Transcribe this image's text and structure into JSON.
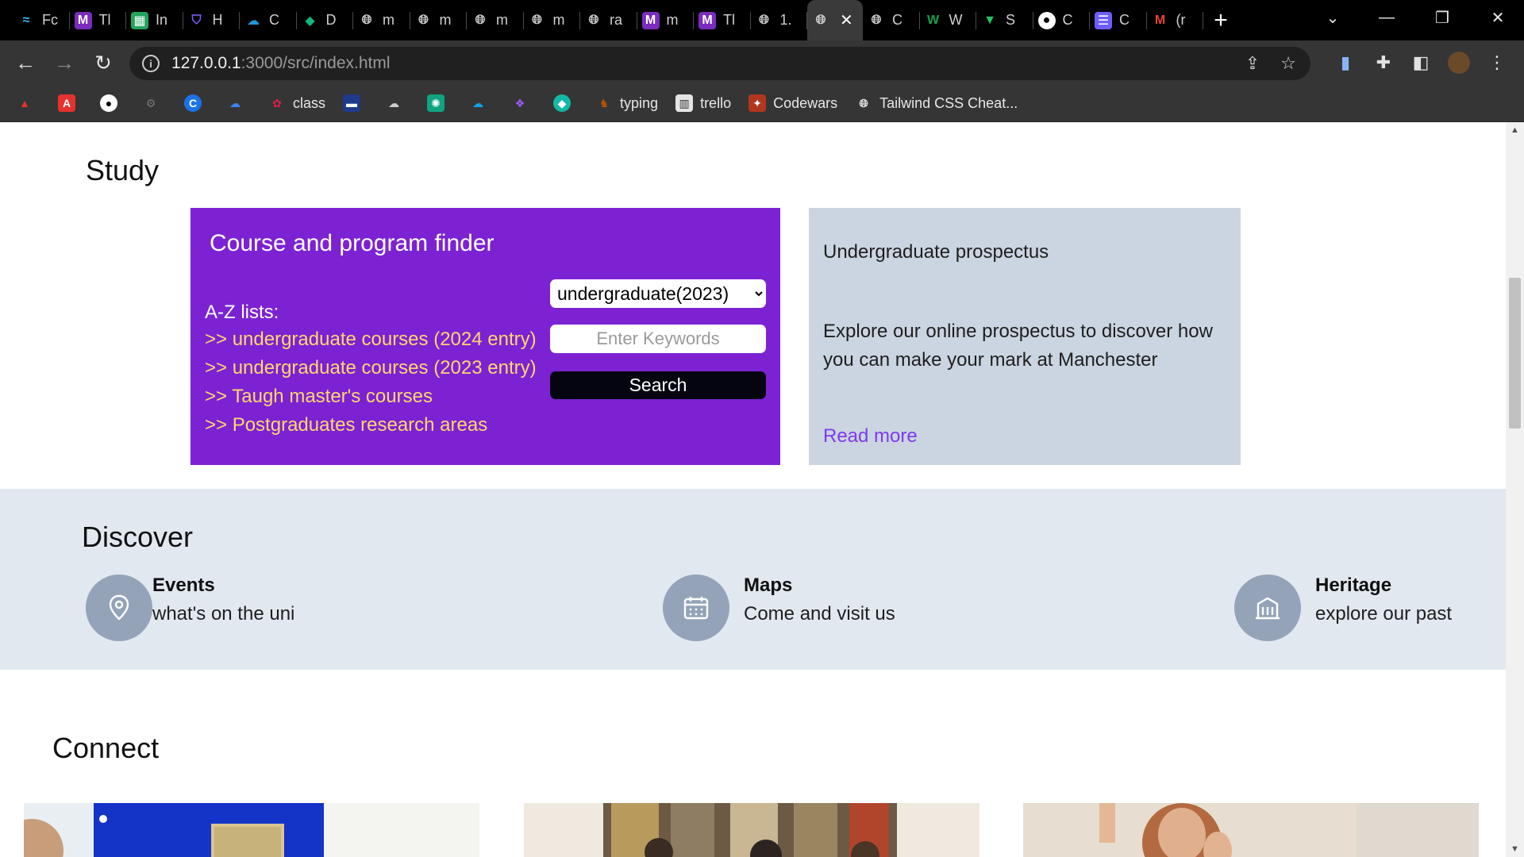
{
  "browser": {
    "tabs": [
      {
        "label": "Fc",
        "icon": "tailwind-icon",
        "color": "#38bdf8"
      },
      {
        "label": "Tl",
        "icon": "m-logo-icon",
        "color": "#7b2cbf"
      },
      {
        "label": "In",
        "icon": "sheet-icon",
        "color": "#22a45d"
      },
      {
        "label": "H",
        "icon": "shield-icon",
        "color": "#7b61ff"
      },
      {
        "label": "C",
        "icon": "cloud-icon",
        "color": "#1e9bd7"
      },
      {
        "label": "D",
        "icon": "droplet-icon",
        "color": "#10b981"
      },
      {
        "label": "m",
        "icon": "globe-icon",
        "color": "#cfcfcf"
      },
      {
        "label": "m",
        "icon": "globe-icon",
        "color": "#cfcfcf"
      },
      {
        "label": "m",
        "icon": "globe-icon",
        "color": "#cfcfcf"
      },
      {
        "label": "m",
        "icon": "globe-icon",
        "color": "#cfcfcf"
      },
      {
        "label": "ra",
        "icon": "globe-icon",
        "color": "#cfcfcf"
      },
      {
        "label": "m",
        "icon": "m-logo-icon",
        "color": "#7b2cbf"
      },
      {
        "label": "Tl",
        "icon": "m-logo-icon",
        "color": "#7b2cbf"
      },
      {
        "label": "1.",
        "icon": "globe-icon",
        "color": "#cfcfcf"
      },
      {
        "label": "",
        "icon": "globe-icon",
        "color": "#cfcfcf",
        "active": true
      },
      {
        "label": "C",
        "icon": "globe-icon",
        "color": "#cfcfcf"
      },
      {
        "label": "W",
        "icon": "w-logo-icon",
        "color": "#16a34a"
      },
      {
        "label": "S",
        "icon": "vue-icon",
        "color": "#22c55e"
      },
      {
        "label": "C",
        "icon": "github-icon",
        "color": "#ffffff"
      },
      {
        "label": "C",
        "icon": "list-icon",
        "color": "#6d5dfc"
      },
      {
        "label": "(r",
        "icon": "gmail-icon",
        "color": "#ea4335"
      }
    ],
    "url_host": "127.0.0.1",
    "url_path": ":3000/src/index.html",
    "bookmarks": [
      {
        "label": "",
        "icon": "adobe-icon",
        "color": "#e5322d"
      },
      {
        "label": "",
        "icon": "pdf-icon",
        "color": "#e5322d"
      },
      {
        "label": "",
        "icon": "github-icon",
        "color": "#222"
      },
      {
        "label": "",
        "icon": "bike-icon",
        "color": "#555"
      },
      {
        "label": "",
        "icon": "c-logo-icon",
        "color": "#1a73e8"
      },
      {
        "label": "",
        "icon": "cloud-icon",
        "color": "#3b82f6"
      },
      {
        "label": "class",
        "icon": "gear-icon",
        "color": "#e11d48"
      },
      {
        "label": "",
        "icon": "bar-icon",
        "color": "#1e3a8a"
      },
      {
        "label": "",
        "icon": "cloud-icon",
        "color": "#888"
      },
      {
        "label": "",
        "icon": "openai-icon",
        "color": "#10a37f"
      },
      {
        "label": "",
        "icon": "salesforce-icon",
        "color": "#0ea5e9"
      },
      {
        "label": "",
        "icon": "figma-icon",
        "color": "#a259ff"
      },
      {
        "label": "",
        "icon": "diamond-icon",
        "color": "#14b8a6"
      },
      {
        "label": "typing",
        "icon": "keyboard-icon",
        "color": "#b45309"
      },
      {
        "label": "trello",
        "icon": "trello-icon",
        "color": "#e5e5e5"
      },
      {
        "label": "Codewars",
        "icon": "codewars-icon",
        "color": "#b1361e"
      },
      {
        "label": "Tailwind CSS Cheat...",
        "icon": "globe-icon",
        "color": "#e5e5e5"
      }
    ]
  },
  "page": {
    "study": {
      "heading": "Study",
      "finder": {
        "title": "Course and program finder",
        "az_label": "A-Z lists:",
        "links": [
          ">> undergraduate courses (2024 entry)",
          ">> undergraduate courses (2023 entry)",
          ">> Taugh master's courses",
          ">> Postgraduates research areas"
        ],
        "select_value": "undergraduate(2023)",
        "keyword_placeholder": "Enter Keywords",
        "search_label": "Search"
      },
      "prospectus": {
        "title": "Undergraduate prospectus",
        "description": "Explore our online prospectus to discover how you can make your mark at Manchester",
        "read_more": "Read more"
      }
    },
    "discover": {
      "heading": "Discover",
      "items": [
        {
          "title": "Events",
          "subtitle": "what's on the uni",
          "icon": "location-pin-icon"
        },
        {
          "title": "Maps",
          "subtitle": "Come and visit us",
          "icon": "calendar-icon"
        },
        {
          "title": "Heritage",
          "subtitle": "explore our past",
          "icon": "building-icon"
        }
      ]
    },
    "connect": {
      "heading": "Connect"
    },
    "colors": {
      "finder_bg": "#7c22d3",
      "finder_links": "#ffd76e",
      "prospectus_bg": "#cbd5e1",
      "discover_bg": "#e2e8f0",
      "discover_circle": "#94a3b8",
      "read_more": "#7c3aed"
    }
  }
}
